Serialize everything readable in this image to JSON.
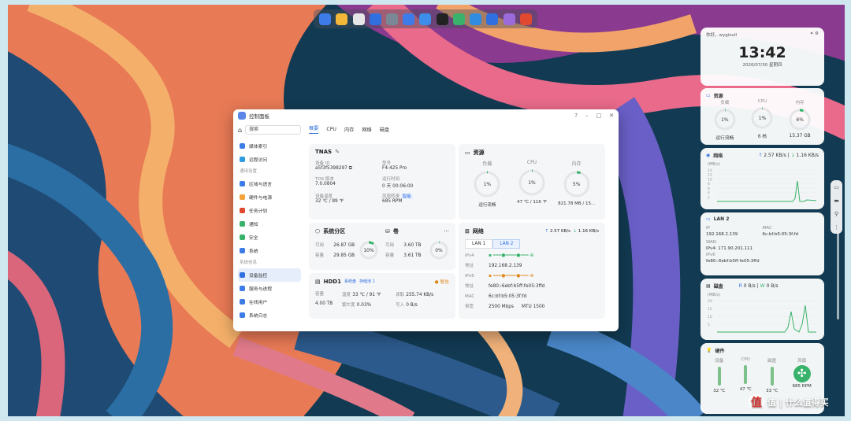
{
  "dock": {
    "apps": [
      {
        "name": "file-manager-icon",
        "color": "#3d7ce8"
      },
      {
        "name": "notes-icon",
        "color": "#f3b73a"
      },
      {
        "name": "app-center-icon",
        "color": "#e6e6e6"
      },
      {
        "name": "clock-icon",
        "color": "#2f6fe0"
      },
      {
        "name": "settings-icon",
        "color": "#7a8796"
      },
      {
        "name": "docs-icon",
        "color": "#3d7ce8"
      },
      {
        "name": "mail-icon",
        "color": "#3d8ee8"
      },
      {
        "name": "terminal-icon",
        "color": "#222222"
      },
      {
        "name": "store-icon",
        "color": "#39b36b"
      },
      {
        "name": "docker-icon",
        "color": "#2f8ce0"
      },
      {
        "name": "headset-icon",
        "color": "#2f6fe0"
      },
      {
        "name": "drive-icon",
        "color": "#9b6bdc"
      },
      {
        "name": "game-icon",
        "color": "#e0482f"
      }
    ]
  },
  "window": {
    "title": "控制面板",
    "sidebar": {
      "search": "搜索",
      "items_top": [
        {
          "label": "媒体索引",
          "color": "#3d7ce8"
        },
        {
          "label": "远程访问",
          "color": "#2f9be0"
        }
      ],
      "section_general": "通用设置",
      "items_general": [
        {
          "label": "区域与语言",
          "color": "#3d7ce8"
        },
        {
          "label": "硬件与电源",
          "color": "#f3a33a"
        },
        {
          "label": "任务计划",
          "color": "#e0482f"
        },
        {
          "label": "通知",
          "color": "#39b36b"
        },
        {
          "label": "安全",
          "color": "#39b36b"
        },
        {
          "label": "系统",
          "color": "#3d7ce8"
        }
      ],
      "section_info": "系统信息",
      "items_info": [
        {
          "label": "设备监控",
          "color": "#2f6fe0",
          "active": true
        },
        {
          "label": "服务与进程",
          "color": "#3d7ce8"
        },
        {
          "label": "在线用户",
          "color": "#3d7ce8"
        },
        {
          "label": "系统日志",
          "color": "#3d7ce8"
        }
      ]
    },
    "tabs": [
      "概要",
      "CPU",
      "内存",
      "网络",
      "磁盘"
    ],
    "device": {
      "title": "TNAS",
      "id_label": "设备 ID",
      "id": "a5f3f5398297",
      "model_label": "型号",
      "model": "F4-425 Pro",
      "tos_label": "TOS 版本",
      "tos": "7.0.0804",
      "uptime_label": "运行时间",
      "uptime": "0 天 00:06:00",
      "temp_label": "设备温度",
      "temp": "32 ℃ / 89 ℉",
      "fan_label": "风扇转速",
      "fan_tag": "智能",
      "fan": "685 RPM"
    },
    "resources": {
      "title": "资源",
      "load_label": "负载",
      "load": "1%",
      "load_pct": 1,
      "cpu_label": "CPU",
      "cpu": "1%",
      "cpu_pct": 1,
      "mem_label": "内存",
      "mem": "5%",
      "mem_pct": 5,
      "load_sub": "运行流畅",
      "cpu_sub": "47 ℃ / 116 ℉",
      "mem_sub": "821.78 MB / 15..."
    },
    "partition": {
      "title": "系统分区",
      "avail_label": "可用",
      "avail": "26.87 GB",
      "cap_label": "容量",
      "cap": "29.85 GB",
      "pct": "10%",
      "pct_val": 10
    },
    "volume": {
      "title": "卷",
      "avail_label": "可用",
      "avail": "3.60 TB",
      "cap_label": "容量",
      "cap": "3.61 TB",
      "pct": "0%",
      "pct_val": 0
    },
    "hdd": {
      "title": "HDD1",
      "tag1": "系统盘",
      "tag2": "存储池 1",
      "warn": "警告",
      "cap_label": "容量",
      "cap": "4.00 TB",
      "temp_label": "温度",
      "temp": "33 ℃ / 91 ℉",
      "busy_label": "繁忙度",
      "busy": "0.03%",
      "read_label": "读取",
      "read": "255.74 KB/s",
      "write_label": "写入",
      "write": "0 B/s"
    },
    "network": {
      "title": "网络",
      "up": "2.57 KB/s",
      "down": "1.16 KB/s",
      "lan_tabs": [
        "LAN 1",
        "LAN 2"
      ],
      "ipv4_label": "IPv4",
      "addr_label": "地址",
      "addr4": "192.168.2.139",
      "ipv6_label": "IPv6",
      "addr6": "fe80::6ebf:b5ff:fe05:3ffd",
      "mac_label": "MAC",
      "mac": "6c:bf:b5:05:3f:fd",
      "speed_label": "带宽",
      "speed": "2500 Mbps",
      "mtu": "MTU 1500"
    }
  },
  "widgets": {
    "clock": {
      "greeting": "你好，wygioull",
      "time": "13:42",
      "date": "2026/07/30 星期四"
    },
    "resource": {
      "title": "资源",
      "load_label": "负载",
      "load": "1%",
      "load_sub": "运行流畅",
      "cpu_label": "CPU",
      "cpu": "1%",
      "cpu_sub": "6 核",
      "mem_label": "内存",
      "mem": "6%",
      "mem_sub": "15.37 GB"
    },
    "network": {
      "title": "网络",
      "up": "2.57 KB/s",
      "down": "1.16 KB/s",
      "unit": "(MB/s)",
      "ticks": [
        "14",
        "12",
        "10",
        "8",
        "6",
        "4",
        "2"
      ]
    },
    "lan": {
      "title": "LAN 2",
      "ip_label": "IP",
      "ip": "192.168.2.139",
      "mac_label": "MAC",
      "mac": "6c:bf:b5:05:3f:fd",
      "wan_label": "WAN",
      "wan": "IPv4: 171.90.201.111",
      "ipv6_label": "IPv6",
      "ipv6": "fe80::6ebf:b5ff:fe05:3ffd"
    },
    "disk": {
      "title": "磁盘",
      "r_label": "R",
      "r": "0 B/s",
      "w_label": "W",
      "w": "0 B/s",
      "unit": "(MB/s)",
      "ticks": [
        "20",
        "15",
        "10",
        "5"
      ]
    },
    "hardware": {
      "title": "硬件",
      "dev_label": "设备",
      "dev": "32 ℃",
      "cpu_label": "CPU",
      "cpu": "47 ℃",
      "disk_label": "磁盘",
      "disk": "33 ℃",
      "fan_label": "风扇",
      "fan": "685 RPM"
    }
  },
  "watermark": "值 | 什么值得买"
}
